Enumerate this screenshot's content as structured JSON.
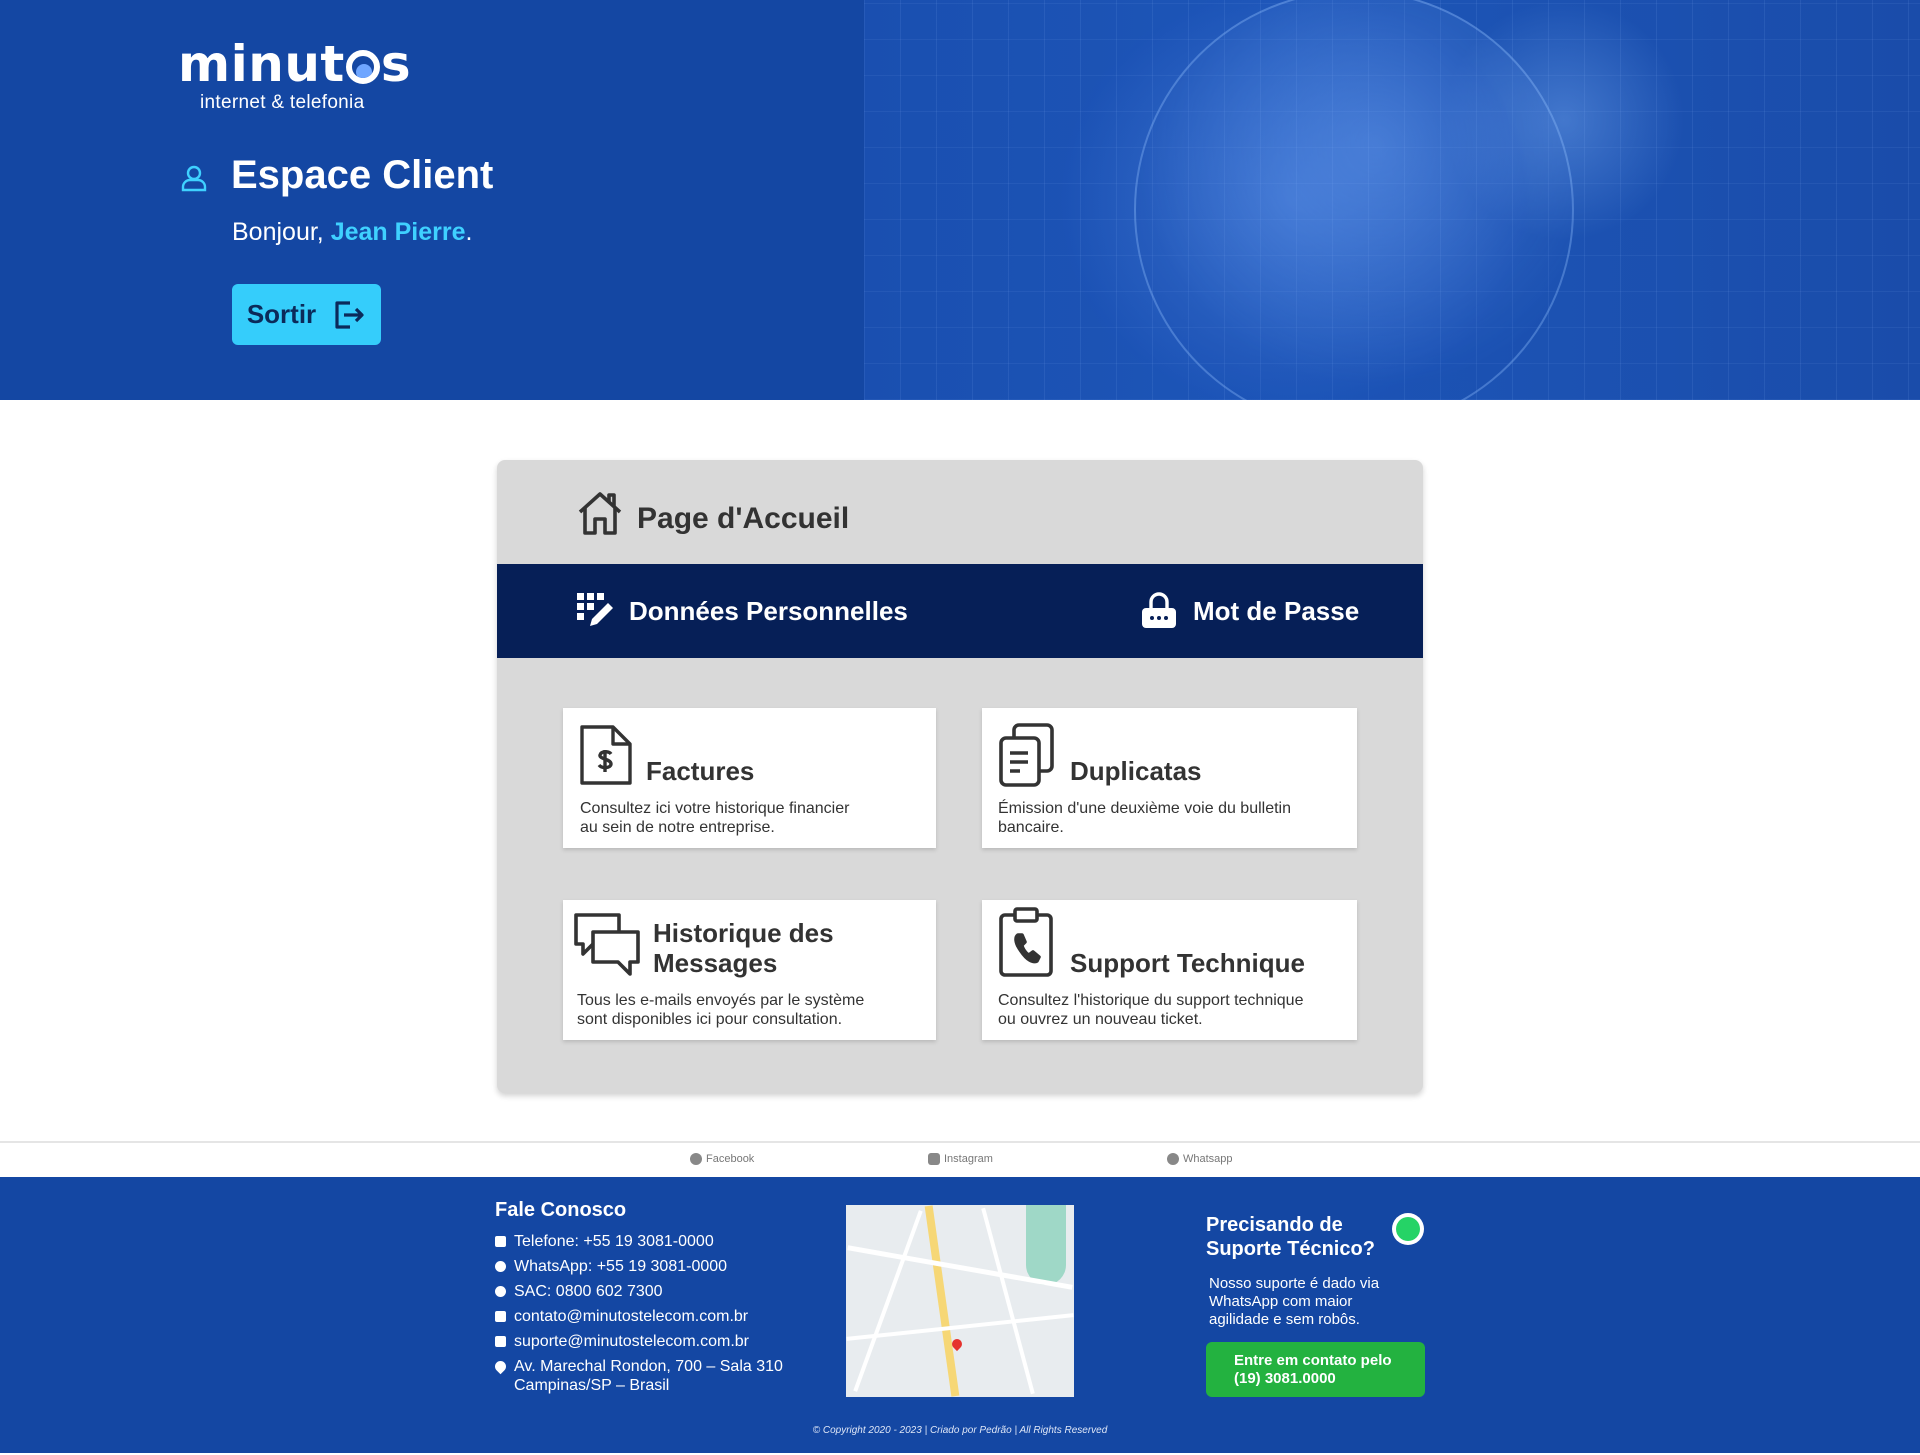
{
  "brand": {
    "logo_text": "minutos",
    "logo_sub": "internet & telefonia"
  },
  "header": {
    "title": "Espace Client",
    "greeting_prefix": "Bonjour,",
    "user_name": "Jean Pierre",
    "greeting_suffix": ".",
    "logout_label": "Sortir"
  },
  "panel": {
    "home_label": "Page d'Accueil",
    "nav": {
      "personal_data_label": "Données Personnelles",
      "password_label": "Mot de Passe"
    },
    "cards": [
      {
        "title": "Factures",
        "desc_line1": "Consultez ici votre historique financier",
        "desc_line2": "au sein de notre entreprise.",
        "icon": "invoice-dollar-icon"
      },
      {
        "title": "Duplicatas",
        "desc_line1": "Émission d'une deuxième voie du bulletin",
        "desc_line2": "bancaire.",
        "icon": "duplicate-docs-icon"
      },
      {
        "title_line1": "Historique des",
        "title_line2": "Messages",
        "desc_line1": "Tous les e-mails envoyés par le système",
        "desc_line2": "sont disponibles ici pour consultation.",
        "icon": "chat-bubbles-icon"
      },
      {
        "title": "Support Technique",
        "desc_line1": "Consultez l'historique du support technique",
        "desc_line2": "ou ouvrez un nouveau ticket.",
        "icon": "clipboard-phone-icon"
      }
    ]
  },
  "social": {
    "facebook": "Facebook",
    "instagram": "Instagram",
    "whatsapp": "Whatsapp"
  },
  "footer": {
    "contact_title": "Fale Conosco",
    "phone": "Telefone: +55 19 3081-0000",
    "whatsapp": "WhatsApp: +55 19 3081-0000",
    "sac": "SAC: 0800 602 7300",
    "email_contact": "contato@minutostelecom.com.br",
    "email_support": "suporte@minutostelecom.com.br",
    "address_line1": "Av. Marechal Rondon, 700 – Sala 310",
    "address_line2": "Campinas/SP – Brasil",
    "support_title": "Precisando de Suporte Técnico?",
    "support_text": "Nosso suporte é dado via WhatsApp com maior agilidade e sem robôs.",
    "support_button_line1": "Entre em contato pelo",
    "support_button_line2": "(19) 3081.0000",
    "copyright": "© Copyright 2020 - 2023 | Criado por Pedrão | All Rights Reserved"
  },
  "colors": {
    "header_blue": "#1447a3",
    "accent_cyan": "#35cdfb",
    "nav_dark": "#061f57",
    "panel_gray": "#d9d9d9",
    "whatsapp_green": "#23b240"
  }
}
